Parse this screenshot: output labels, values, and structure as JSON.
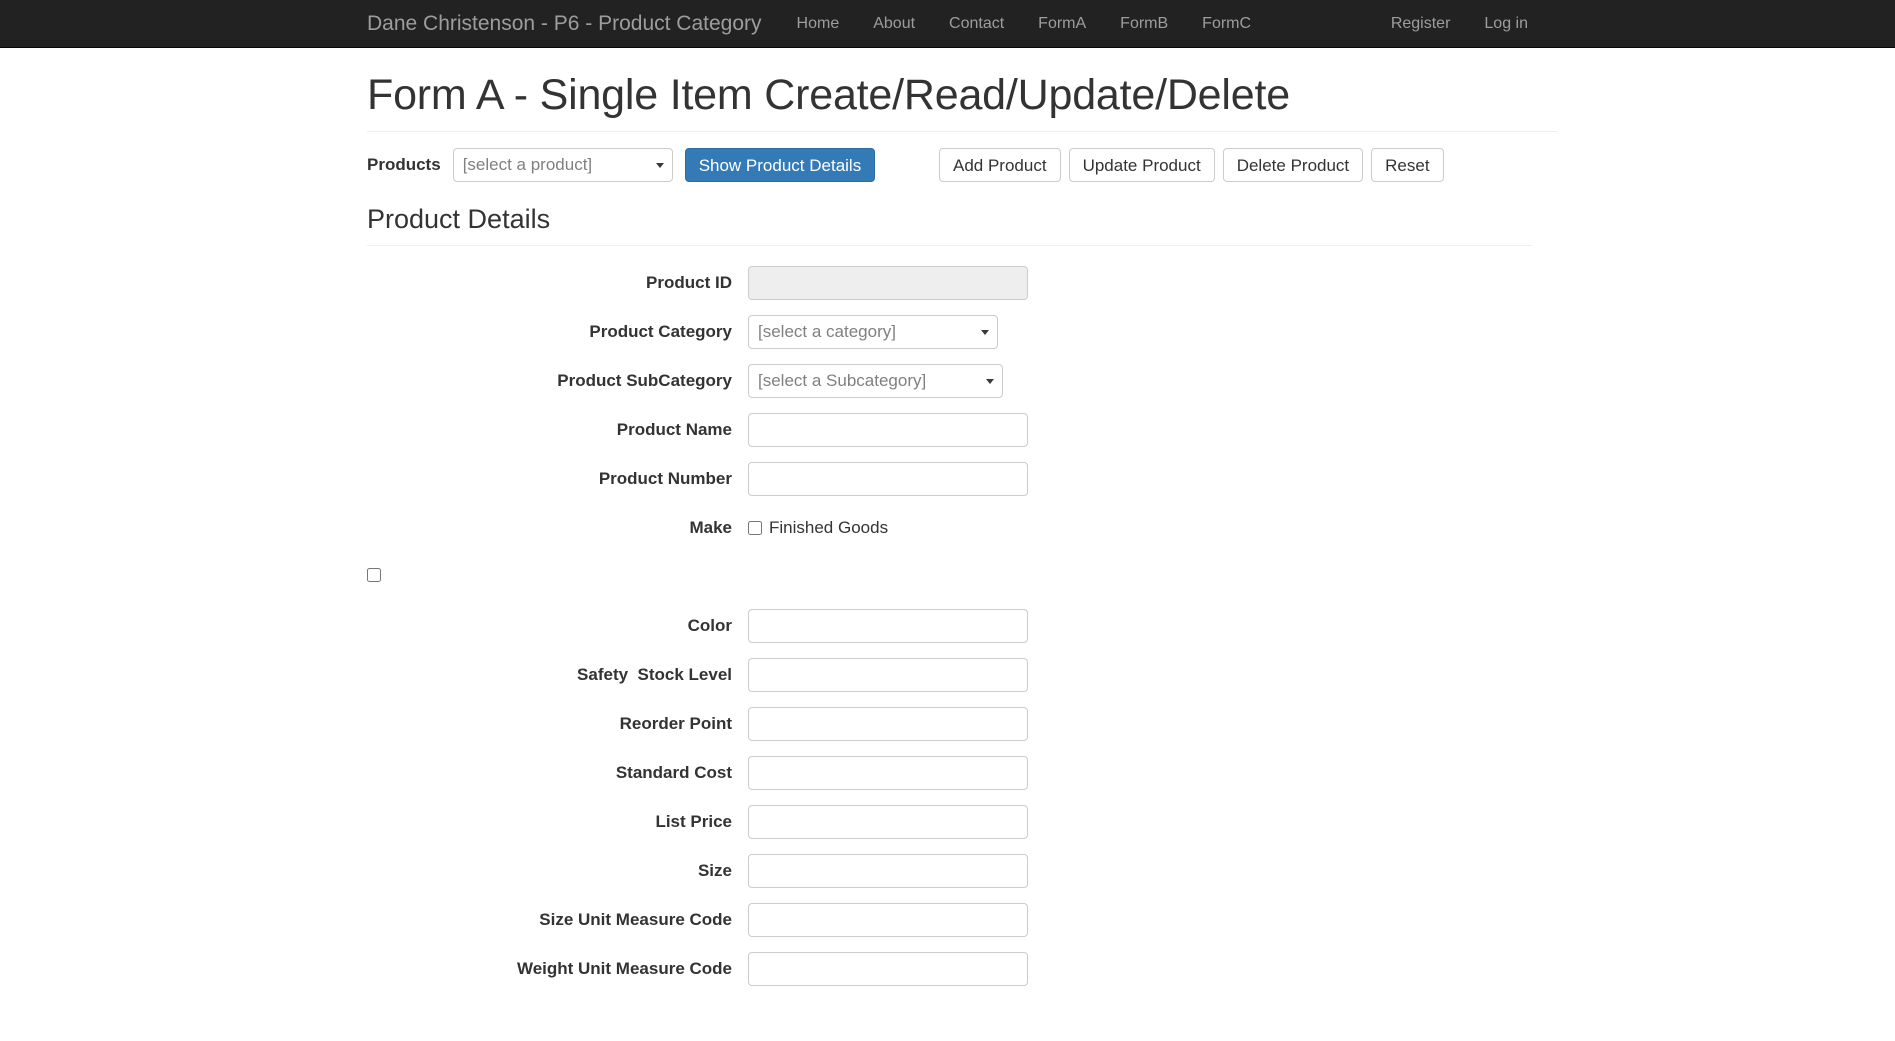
{
  "navbar": {
    "brand": "Dane Christenson - P6 - Product Category",
    "left_links": [
      {
        "label": "Home",
        "name": "nav-link-home"
      },
      {
        "label": "About",
        "name": "nav-link-about"
      },
      {
        "label": "Contact",
        "name": "nav-link-contact"
      },
      {
        "label": "FormA",
        "name": "nav-link-forma"
      },
      {
        "label": "FormB",
        "name": "nav-link-formb"
      },
      {
        "label": "FormC",
        "name": "nav-link-formc"
      }
    ],
    "right_links": [
      {
        "label": "Register",
        "name": "nav-link-register"
      },
      {
        "label": "Log in",
        "name": "nav-link-login"
      }
    ],
    "background_color": "#222222",
    "link_color": "#9d9d9d"
  },
  "page": {
    "title": "Form A - Single Item Create/Read/Update/Delete"
  },
  "toolbar": {
    "products_label": "Products",
    "product_select_value": "[select a product]",
    "show_details_label": "Show Product Details",
    "add_label": "Add Product",
    "update_label": "Update Product",
    "delete_label": "Delete Product",
    "reset_label": "Reset",
    "primary_color": "#337ab7"
  },
  "details": {
    "section_title": "Product Details",
    "fields": {
      "product_id": {
        "label": "Product ID",
        "value": "",
        "type": "text-disabled"
      },
      "product_category": {
        "label": "Product Category",
        "value": "[select a category]",
        "type": "select"
      },
      "product_subcategory": {
        "label": "Product SubCategory",
        "value": "[select a Subcategory]",
        "type": "select"
      },
      "product_name": {
        "label": "Product Name",
        "value": "",
        "type": "text"
      },
      "product_number": {
        "label": "Product Number",
        "value": "",
        "type": "text"
      },
      "make": {
        "label": "Make",
        "checkbox_label": "Finished Goods",
        "checked": false,
        "type": "checkbox"
      },
      "color": {
        "label": "Color",
        "value": "",
        "type": "text"
      },
      "safety_stock_level": {
        "label": "Safety  Stock Level",
        "value": "",
        "type": "text"
      },
      "reorder_point": {
        "label": "Reorder Point",
        "value": "",
        "type": "text"
      },
      "standard_cost": {
        "label": "Standard Cost",
        "value": "",
        "type": "text"
      },
      "list_price": {
        "label": "List Price",
        "value": "",
        "type": "text"
      },
      "size": {
        "label": "Size",
        "value": "",
        "type": "text"
      },
      "size_unit_measure_code": {
        "label": "Size Unit Measure Code",
        "value": "",
        "type": "text"
      },
      "weight_unit_measure_code": {
        "label": "Weight Unit Measure Code",
        "value": "",
        "type": "text"
      }
    }
  }
}
